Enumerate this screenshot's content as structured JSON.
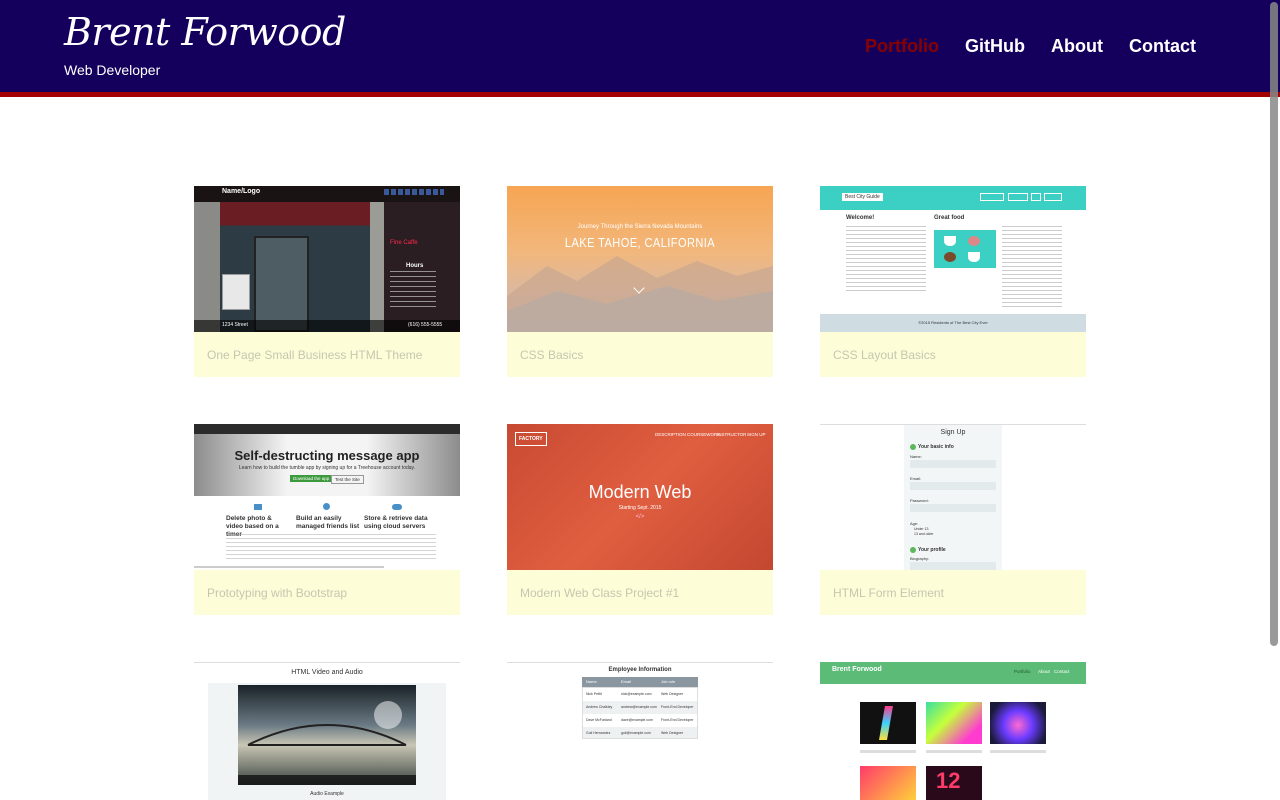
{
  "header": {
    "brand_name": "Brent Forwood",
    "tagline": "Web Developer",
    "nav": [
      {
        "label": "Portfolio",
        "active": true
      },
      {
        "label": "GitHub",
        "active": false
      },
      {
        "label": "About",
        "active": false
      },
      {
        "label": "Contact",
        "active": false
      }
    ]
  },
  "colors": {
    "header_bg": "#14005c",
    "header_border": "#a30000",
    "active_nav": "#8a0000",
    "caption_bg": "#fdfed8"
  },
  "projects": [
    {
      "caption": "One Page Small Business HTML Theme",
      "thumb": {
        "logo": "Name/Logo",
        "hours_title": "Hours",
        "footer_left": "1234 Street",
        "footer_right": "(616) 555-5555"
      }
    },
    {
      "caption": "CSS Basics",
      "thumb": {
        "subtitle": "Journey Through the Sierra Nevada Mountains",
        "title": "LAKE TAHOE, CALIFORNIA"
      }
    },
    {
      "caption": "CSS Layout Basics",
      "thumb": {
        "logo": "Best City Guide",
        "heading_left": "Welcome!",
        "heading_right": "Great food",
        "footer": "©2015 Residents of The Best City Ever"
      }
    },
    {
      "caption": "Prototyping with Bootstrap",
      "thumb": {
        "title": "Self-destructing message app",
        "subtitle": "Learn how to build the tumble app by signing up for a Treehouse account today.",
        "button": "Download the app",
        "button2": "Test the Site",
        "features": [
          "Delete photo & video based on a timer",
          "Build an easily managed friends list",
          "Store & retrieve data using cloud servers"
        ]
      }
    },
    {
      "caption": "Modern Web Class Project #1",
      "thumb": {
        "logo": "FACTORY",
        "nav": [
          "DESCRIPTION",
          "COURSEWORK",
          "INSTRUCTOR",
          "SIGN UP"
        ],
        "title": "Modern Web",
        "subtitle": "Starting Sept. 2015"
      }
    },
    {
      "caption": "HTML Form Element",
      "thumb": {
        "title": "Sign Up",
        "section1": "Your basic info",
        "fields": [
          "Name:",
          "Email:",
          "Password:"
        ],
        "age": "Age:",
        "age_options": [
          "Under 13",
          "13 and older"
        ],
        "section2": "Your profile",
        "bio": "Biography:"
      }
    },
    {
      "caption": "",
      "thumb": {
        "title": "HTML Video and Audio",
        "audio_label": "Audio Example"
      }
    },
    {
      "caption": "",
      "thumb": {
        "title": "Employee Information",
        "headers": [
          "Name",
          "Email",
          "Job role"
        ],
        "rows": [
          [
            "Nick Pettit",
            "nick@example.com",
            "Web Designer"
          ],
          [
            "Andrew Chalkley",
            "andrew@example.com",
            "Front-End Developer"
          ],
          [
            "Dave McFarland",
            "dave@example.com",
            "Front-End Developer"
          ],
          [
            "Guil Hernandez",
            "guil@example.com",
            "Web Designer"
          ]
        ]
      }
    },
    {
      "caption": "",
      "thumb": {
        "brand": "Brent Forwood",
        "nav": [
          "Portfolio",
          "About",
          "Contact"
        ]
      }
    }
  ]
}
